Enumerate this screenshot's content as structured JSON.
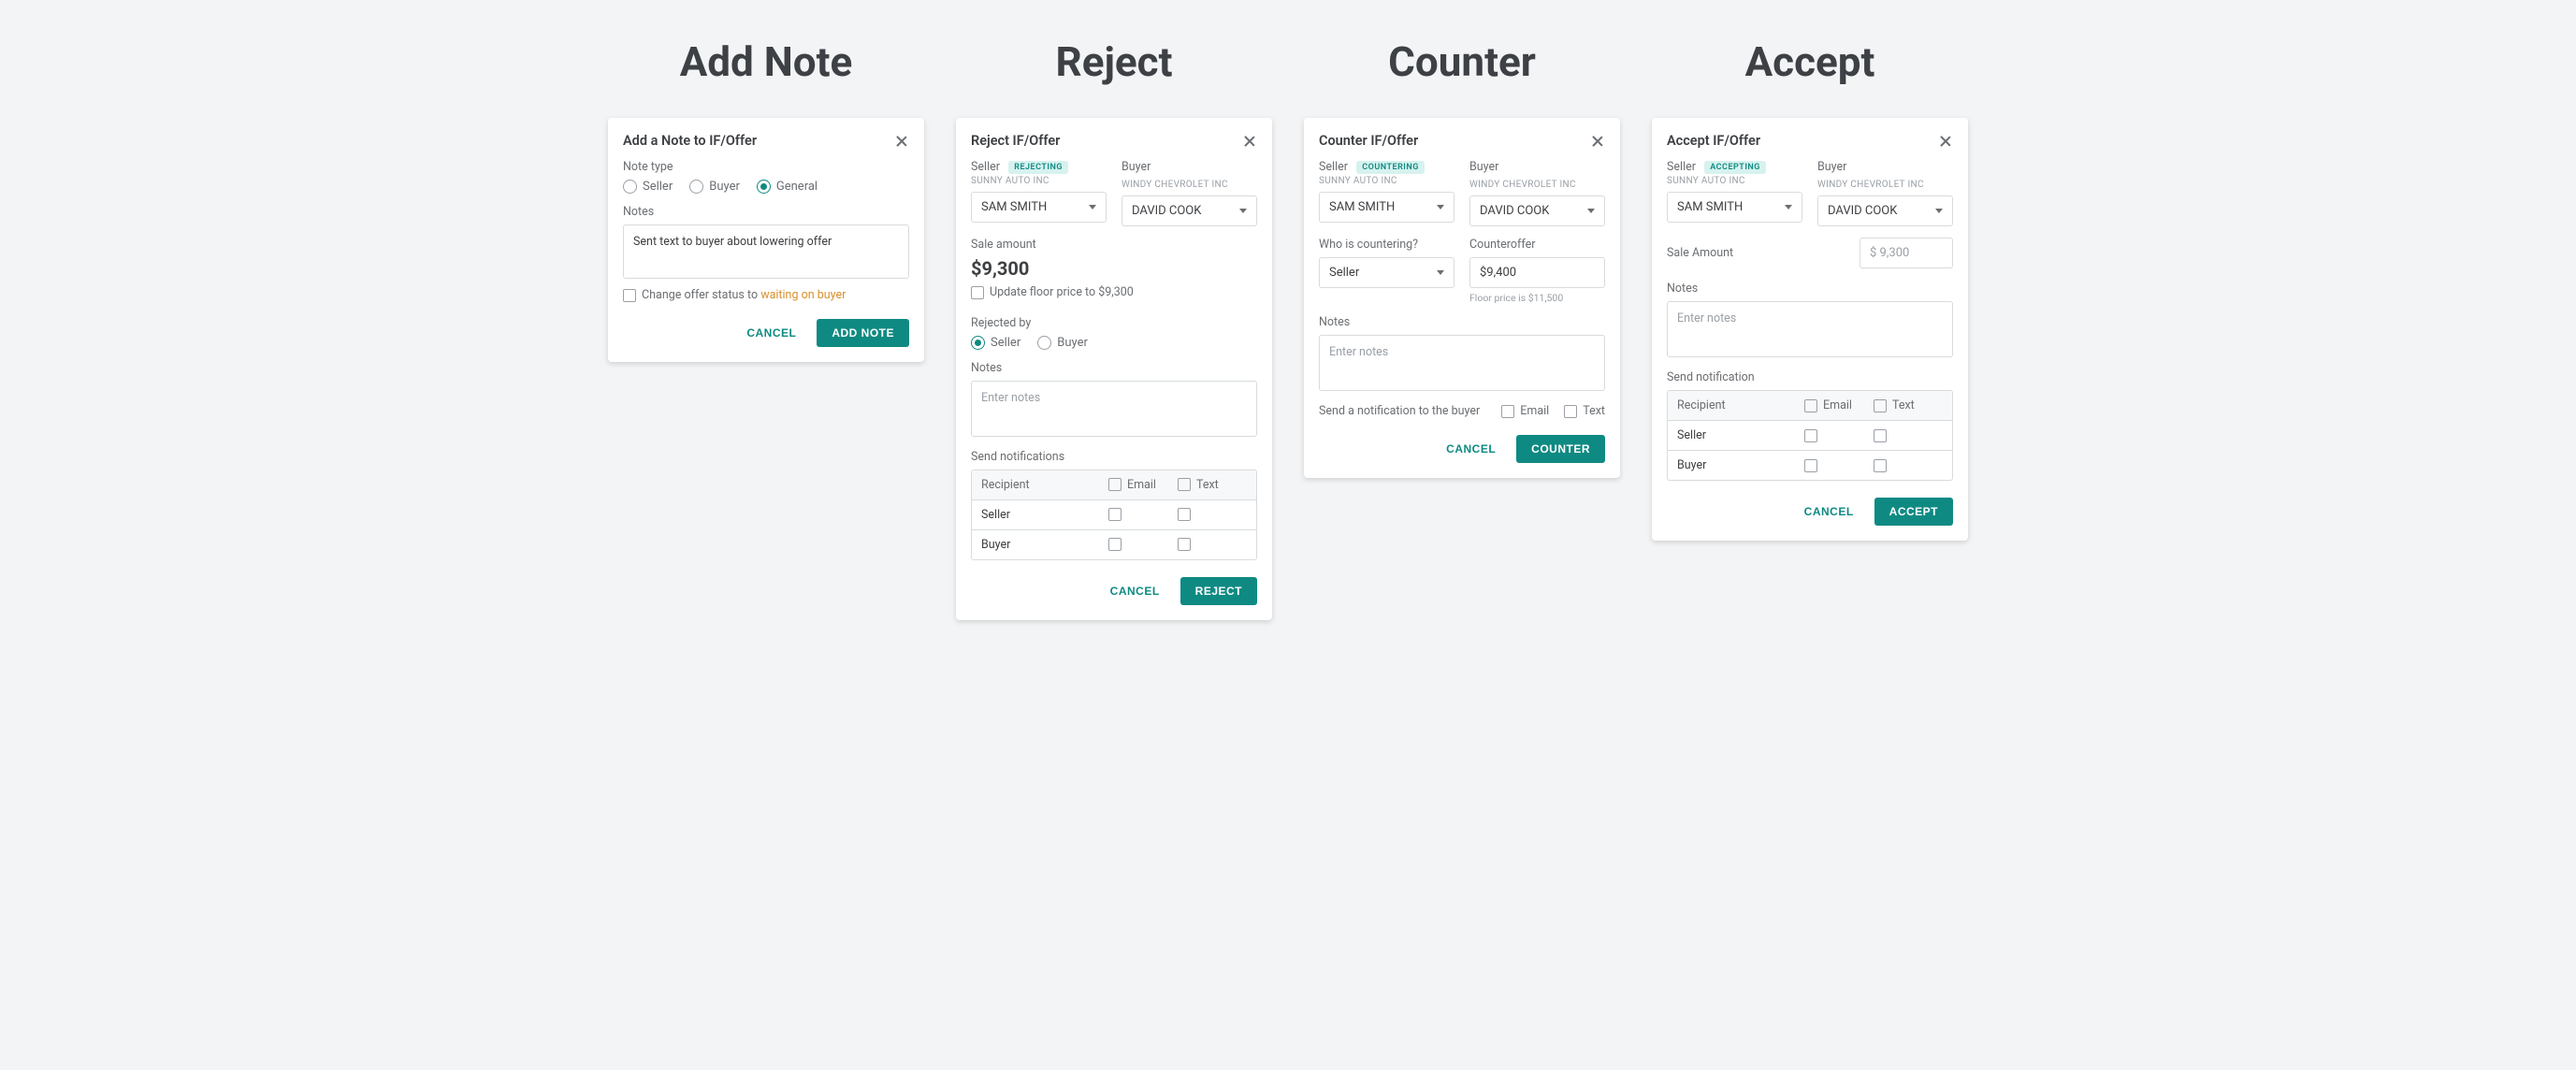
{
  "columns": {
    "addNote": {
      "title": "Add Note"
    },
    "reject": {
      "title": "Reject"
    },
    "counter": {
      "title": "Counter"
    },
    "accept": {
      "title": "Accept"
    }
  },
  "addNoteCard": {
    "title": "Add a Note to IF/Offer",
    "noteTypeLabel": "Note type",
    "radios": {
      "seller": "Seller",
      "buyer": "Buyer",
      "general": "General"
    },
    "selectedRadio": "general",
    "notesLabel": "Notes",
    "notesValue": "Sent text to buyer about lowering offer",
    "statusCheckboxPrefix": "Change offer status to ",
    "statusCheckboxHighlight": "waiting on buyer",
    "cancel": "CANCEL",
    "submit": "ADD NOTE"
  },
  "common": {
    "sellerLabel": "Seller",
    "buyerLabel": "Buyer",
    "sellerOrg": "SUNNY AUTO INC",
    "buyerOrg": "WINDY CHEVROLET INC",
    "sellerSelected": "SAM SMITH",
    "buyerSelected": "DAVID COOK",
    "notesLabel": "Notes",
    "notesPlaceholder": "Enter notes",
    "cancel": "CANCEL",
    "notifRecipient": "Recipient",
    "notifEmail": "Email",
    "notifText": "Text",
    "notifSeller": "Seller",
    "notifBuyer": "Buyer"
  },
  "rejectCard": {
    "title": "Reject IF/Offer",
    "badge": "REJECTING",
    "saleAmountLabel": "Sale amount",
    "saleAmount": "$9,300",
    "updateFloor": "Update floor price to $9,300",
    "rejectedByLabel": "Rejected by",
    "rejectedBySelected": "seller",
    "sendLabel": "Send notifications",
    "submit": "REJECT"
  },
  "counterCard": {
    "title": "Counter IF/Offer",
    "badge": "COUNTERING",
    "whoLabel": "Who is countering?",
    "whoSelected": "Seller",
    "counterofferLabel": "Counteroffer",
    "counterofferValue": "$9,400",
    "floorHelper": "Floor price is $11,500",
    "sendLabel": "Send a notification to the buyer",
    "submit": "COUNTER"
  },
  "acceptCard": {
    "title": "Accept IF/Offer",
    "badge": "ACCEPTING",
    "saleAmountLabel": "Sale Amount",
    "saleAmountValue": "$ 9,300",
    "sendLabel": "Send notification",
    "submit": "ACCEPT"
  }
}
